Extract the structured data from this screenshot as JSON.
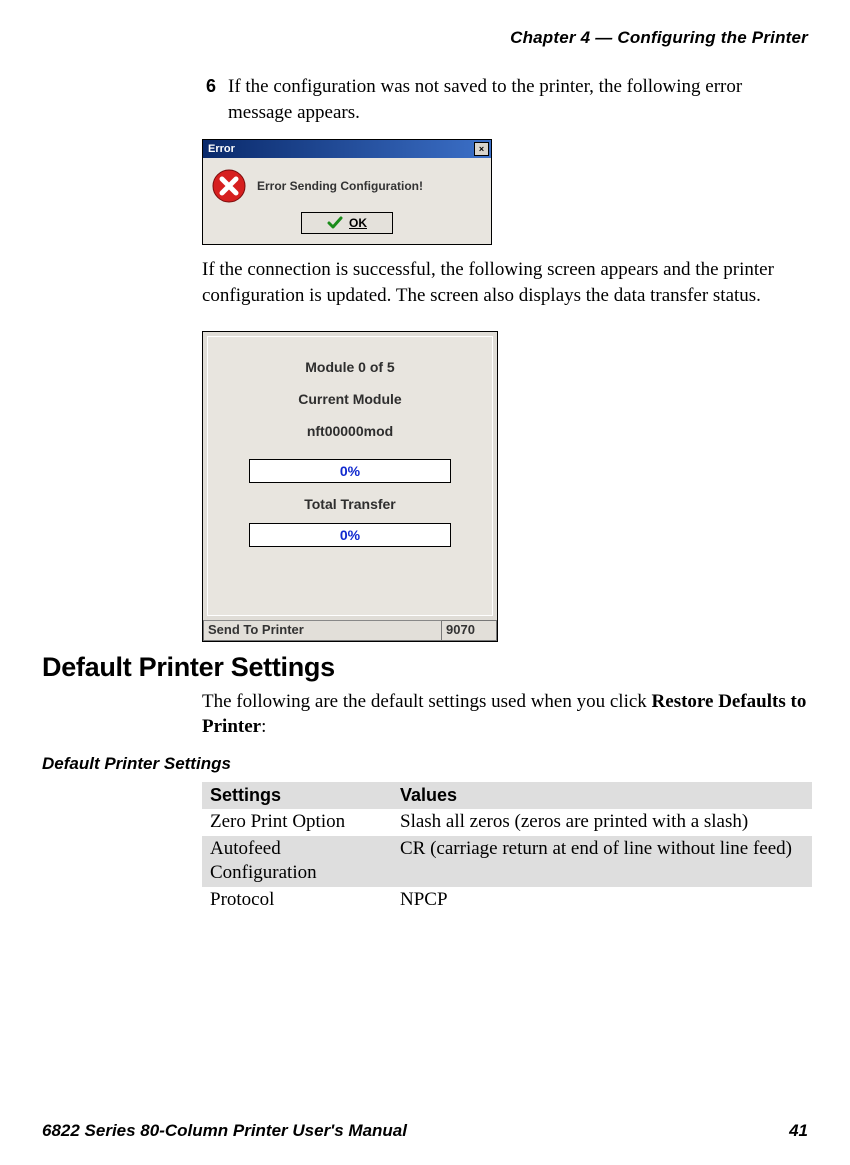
{
  "header": {
    "chapter": "Chapter 4 — Configuring the Printer"
  },
  "step6": {
    "number": "6",
    "text": "If the configuration was not saved to the printer, the following error message appears."
  },
  "error_dialog": {
    "title": "Error",
    "close_glyph": "×",
    "message": "Error Sending Configuration!",
    "ok_label": "OK"
  },
  "para_success": "If the connection is successful, the following screen appears and the printer configuration is updated. The screen also displays the data transfer status.",
  "transfer_dialog": {
    "module_line": "Module  0  of  5",
    "current_module_label": "Current Module",
    "module_name": "nft00000mod",
    "progress1": "0%",
    "total_label": "Total Transfer",
    "progress2": "0%",
    "status_label": "Send To Printer",
    "status_code": "9070"
  },
  "heading": "Default Printer Settings",
  "heading_para_pre": "The following are the default settings used when you click ",
  "heading_para_bold": "Restore Defaults to Printer",
  "heading_para_post": ":",
  "table_caption": "Default Printer Settings",
  "table": {
    "col_settings": "Settings",
    "col_values": "Values",
    "rows": [
      {
        "setting": "Zero Print Option",
        "value": "Slash all zeros (zeros are printed with a slash)"
      },
      {
        "setting": "Autofeed Configuration",
        "value": "CR (carriage return at end of line without line feed)"
      },
      {
        "setting": "Protocol",
        "value": "NPCP"
      }
    ]
  },
  "footer": {
    "manual": "6822 Series 80-Column Printer User's Manual",
    "page": "41"
  }
}
